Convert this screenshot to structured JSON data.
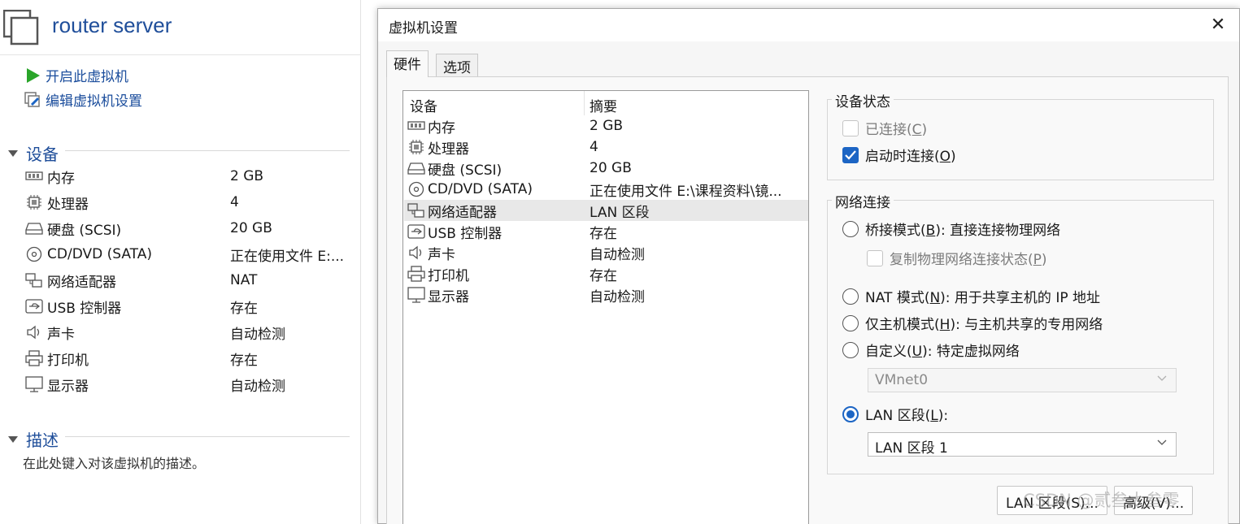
{
  "vm": {
    "title": "router server",
    "actions": [
      {
        "label": "开启此虚拟机",
        "icon": "play-icon"
      },
      {
        "label": "编辑虚拟机设置",
        "icon": "edit-settings-icon"
      }
    ],
    "devices_heading": "设备",
    "devices": [
      {
        "name": "内存",
        "value": "2 GB",
        "icon": "memory-icon"
      },
      {
        "name": "处理器",
        "value": "4",
        "icon": "cpu-icon"
      },
      {
        "name": "硬盘 (SCSI)",
        "value": "20 GB",
        "icon": "harddisk-icon"
      },
      {
        "name": "CD/DVD (SATA)",
        "value": "正在使用文件 E:...",
        "icon": "cd-icon"
      },
      {
        "name": "网络适配器",
        "value": "NAT",
        "icon": "network-adapter-icon"
      },
      {
        "name": "USB 控制器",
        "value": "存在",
        "icon": "usb-icon"
      },
      {
        "name": "声卡",
        "value": "自动检测",
        "icon": "sound-icon"
      },
      {
        "name": "打印机",
        "value": "存在",
        "icon": "printer-icon"
      },
      {
        "name": "显示器",
        "value": "自动检测",
        "icon": "display-icon"
      }
    ],
    "description_heading": "描述",
    "description_placeholder": "在此处键入对该虚拟机的描述。"
  },
  "dialog": {
    "title": "虚拟机设置",
    "close": "✕",
    "tabs": [
      "硬件",
      "选项"
    ],
    "active_tab": "硬件",
    "list": {
      "col_device": "设备",
      "col_summary": "摘要",
      "rows": [
        {
          "name": "内存",
          "summary": "2 GB",
          "icon": "memory-icon"
        },
        {
          "name": "处理器",
          "summary": "4",
          "icon": "cpu-icon"
        },
        {
          "name": "硬盘 (SCSI)",
          "summary": "20 GB",
          "icon": "harddisk-icon"
        },
        {
          "name": "CD/DVD (SATA)",
          "summary": "正在使用文件 E:\\课程资料\\镜...",
          "icon": "cd-icon"
        },
        {
          "name": "网络适配器",
          "summary": "LAN 区段",
          "icon": "network-adapter-icon",
          "selected": true
        },
        {
          "name": "USB 控制器",
          "summary": "存在",
          "icon": "usb-icon"
        },
        {
          "name": "声卡",
          "summary": "自动检测",
          "icon": "sound-icon"
        },
        {
          "name": "打印机",
          "summary": "存在",
          "icon": "printer-icon"
        },
        {
          "name": "显示器",
          "summary": "自动检测",
          "icon": "display-icon"
        }
      ]
    },
    "device_status": {
      "label": "设备状态",
      "connected": {
        "text": "已连接(",
        "key": "C",
        "end": ")",
        "checked": false,
        "disabled": true
      },
      "connect_at_power_on": {
        "text": "启动时连接(",
        "key": "O",
        "end": ")",
        "checked": true
      }
    },
    "network": {
      "label": "网络连接",
      "bridged": {
        "text": "桥接模式(",
        "key": "B",
        "end": "): 直接连接物理网络",
        "checked": false
      },
      "replicate": {
        "text": "复制物理网络连接状态(",
        "key": "P",
        "end": ")",
        "checked": false,
        "disabled": true
      },
      "nat": {
        "text": "NAT 模式(",
        "key": "N",
        "end": "): 用于共享主机的 IP 地址",
        "checked": false
      },
      "host_only": {
        "text": "仅主机模式(",
        "key": "H",
        "end": "): 与主机共享的专用网络",
        "checked": false
      },
      "custom": {
        "text": "自定义(",
        "key": "U",
        "end": "): 特定虚拟网络",
        "checked": false
      },
      "custom_select": "VMnet0",
      "lan": {
        "text": "LAN 区段(",
        "key": "L",
        "end": "):",
        "checked": true
      },
      "lan_select": "LAN 区段 1"
    },
    "buttons": {
      "lan_segments": "LAN 区段(S)...",
      "advanced": "高级(V)..."
    },
    "watermark": "CSDN @贰叁太叁零"
  },
  "colors": {
    "accent": "#1c65c4",
    "title_blue": "#1f4e9a",
    "play_green": "#2aa52a"
  }
}
